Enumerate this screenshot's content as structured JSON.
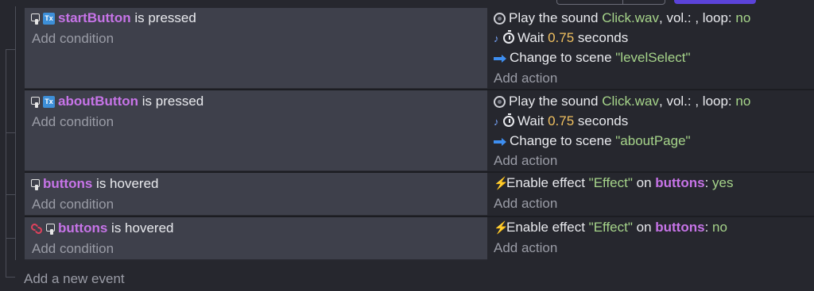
{
  "events": [
    {
      "condition": {
        "object": "startButton",
        "text": " is pressed",
        "inverted": false
      },
      "add_condition": "Add condition",
      "actions": [
        {
          "type": "sound",
          "pre": "Play the sound ",
          "file": "Click.wav",
          "mid": ", vol.: , loop: ",
          "loop": "no"
        },
        {
          "type": "wait",
          "pre": "Wait ",
          "value": "0.75",
          "post": " seconds"
        },
        {
          "type": "scene",
          "pre": "Change to scene ",
          "scene": "\"levelSelect\""
        }
      ],
      "add_action": "Add action"
    },
    {
      "condition": {
        "object": "aboutButton",
        "text": " is pressed",
        "inverted": false
      },
      "add_condition": "Add condition",
      "actions": [
        {
          "type": "sound",
          "pre": "Play the sound ",
          "file": "Click.wav",
          "mid": ", vol.: , loop: ",
          "loop": "no"
        },
        {
          "type": "wait",
          "pre": "Wait ",
          "value": "0.75",
          "post": " seconds"
        },
        {
          "type": "scene",
          "pre": "Change to scene ",
          "scene": "\"aboutPage\""
        }
      ],
      "add_action": "Add action"
    },
    {
      "condition": {
        "object": "buttons",
        "text": " is hovered",
        "inverted": false
      },
      "add_condition": "Add condition",
      "actions": [
        {
          "type": "effect",
          "pre": "Enable effect ",
          "effect": "\"Effect\"",
          "on": " on ",
          "object": "buttons",
          "colon": ": ",
          "value": "yes"
        }
      ],
      "add_action": "Add action"
    },
    {
      "condition": {
        "object": "buttons",
        "text": " is hovered",
        "inverted": true
      },
      "add_condition": "Add condition",
      "actions": [
        {
          "type": "effect",
          "pre": "Enable effect ",
          "effect": "\"Effect\"",
          "on": " on ",
          "object": "buttons",
          "colon": ": ",
          "value": "no"
        }
      ],
      "add_action": "Add action"
    }
  ],
  "add_event": "Add a new event",
  "colors": {
    "object": "#c774e8",
    "string": "#a6d48a",
    "number": "#f0c060",
    "accent": "#5b43d9"
  },
  "icons": {
    "pressed": "cursor-hand-icon",
    "sprite": "text-object-icon",
    "sound": "sound-icon",
    "wait": "timer-icon",
    "scene": "scene-arrow-icon",
    "effect": "lightning-icon",
    "invert": "invert-icon"
  }
}
